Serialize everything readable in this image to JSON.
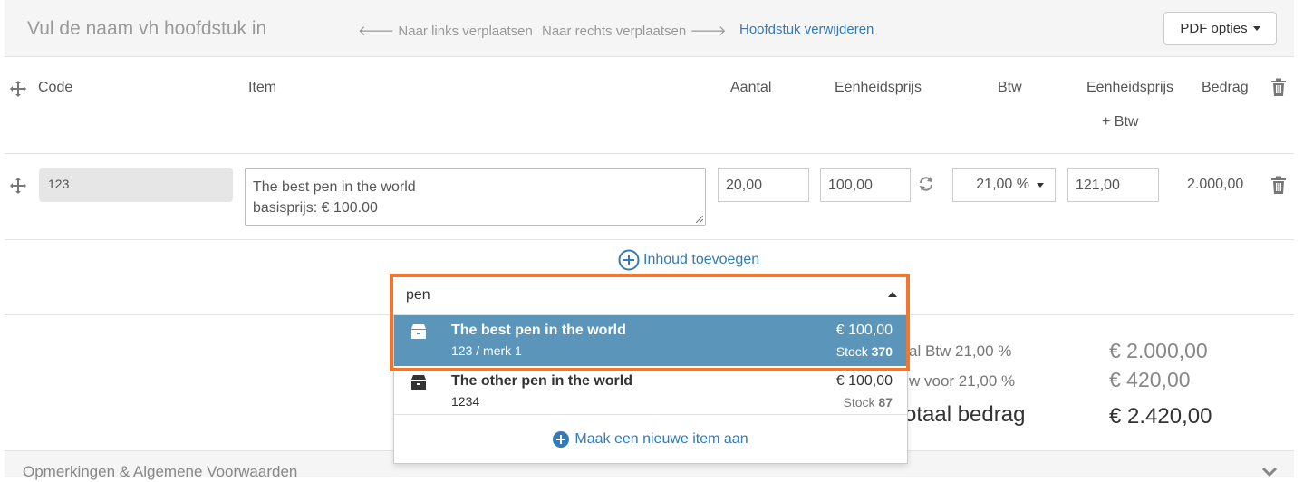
{
  "chapter": {
    "title_placeholder": "Vul de naam vh hoofdstuk in",
    "move_left": "Naar links verplaatsen",
    "move_right": "Naar rechts verplaatsen",
    "delete_chapter": "Hoofdstuk verwijderen",
    "pdf_options": "PDF opties"
  },
  "table": {
    "headers": {
      "code": "Code",
      "item": "Item",
      "quantity": "Aantal",
      "unit_price": "Eenheidsprijs",
      "vat": "Btw",
      "unit_price_vat_line1": "Eenheidsprijs",
      "unit_price_vat_line2": "+ Btw",
      "amount": "Bedrag"
    },
    "row": {
      "code": "123",
      "item_line1": "The best pen in the world",
      "item_line2": "basisprijs: € 100.00",
      "quantity": "20,00",
      "unit_price": "100,00",
      "vat": "21,00 %",
      "unit_price_vat": "121,00",
      "amount": "2.000,00"
    }
  },
  "add_content": "Inhoud toevoegen",
  "search": {
    "value": "pen",
    "options": [
      {
        "title": "The best pen in the world",
        "sub": "123  / merk 1",
        "price": "€ 100,00",
        "stock_label": "Stock",
        "stock_value": "370",
        "selected": true
      },
      {
        "title": "The other pen in the world",
        "sub": "1234",
        "price": "€ 100,00",
        "stock_label": "Stock",
        "stock_value": "87",
        "selected": false
      }
    ],
    "create_new": "Maak een nieuwe item aan"
  },
  "totals": {
    "subtotal_label": "al  Btw 21,00 %",
    "subtotal_value": "€ 2.000,00",
    "vat_label": "w voor 21,00 %",
    "vat_value": "€ 420,00",
    "total_label": "otaal bedrag",
    "total_value": "€ 2.420,00"
  },
  "footer": {
    "title": "Opmerkingen & Algemene Voorwaarden"
  },
  "colors": {
    "accent": "#337ab7",
    "selected_bg": "#5b96ba",
    "highlight_frame": "#f0782d"
  }
}
